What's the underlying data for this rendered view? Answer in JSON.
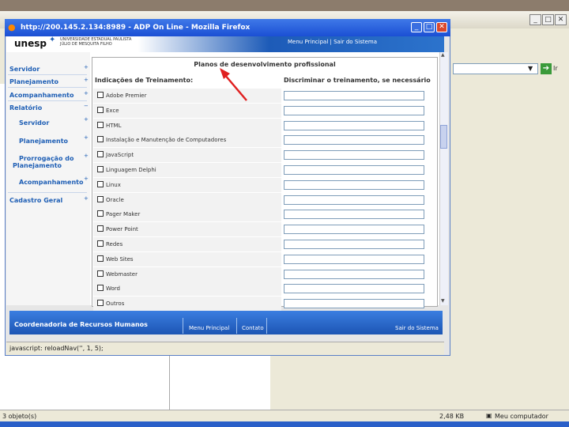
{
  "background_window": {
    "go_label": "Ir",
    "status_left": "3 objeto(s)",
    "status_size": "2,48 KB",
    "status_zone": "Meu computador"
  },
  "popup": {
    "title": "http://200.145.2.134:8989 - ADP On Line - Mozilla Firefox",
    "status": "javascript: reloadNav('', 1, 5);"
  },
  "header": {
    "logo": "unesp",
    "logo_sub1": "UNIVERSIDADE ESTADUAL PAULISTA",
    "logo_sub2": "JÚLIO DE MESQUITA FILHO",
    "top_menu": "Menu Principal | Sair do Sistema"
  },
  "sidebar": {
    "servidor": "Servidor",
    "planejamento": "Planejamento",
    "acompanhamento": "Acompanhamento",
    "relatorio": "Relatório",
    "rel_servidor": "Servidor",
    "rel_planejamento": "Planejamento",
    "rel_prorrogacao_1": "Prorrogação do",
    "rel_prorrogacao_2": "Planejamento",
    "rel_acompanhamento": "Acompanhamento",
    "cadastro_geral": "Cadastro Geral"
  },
  "form": {
    "title": "Planos de desenvolvimento profissional",
    "col_indicacoes": "Indicações de Treinamento:",
    "col_discriminar": "Discriminar o treinamento, se necessário",
    "items": [
      "Adobe Premier",
      "Exce",
      "HTML",
      "Instalação e Manutenção de Computadores",
      "JavaScript",
      "Linguagem Delphi",
      "Linux",
      "Oracle",
      "Pager Maker",
      "Power Point",
      "Redes",
      "Web Sites",
      "Webmaster",
      "Word",
      "Outros"
    ]
  },
  "footer": {
    "title": "Coordenadoria de Recursos Humanos",
    "menu_principal": "Menu Principal",
    "contato": "Contato",
    "sair": "Sair do Sistema"
  },
  "colors": {
    "accent": "#1f5fb5",
    "titlebar": "#1b4fd4",
    "arrow": "#e02020"
  }
}
